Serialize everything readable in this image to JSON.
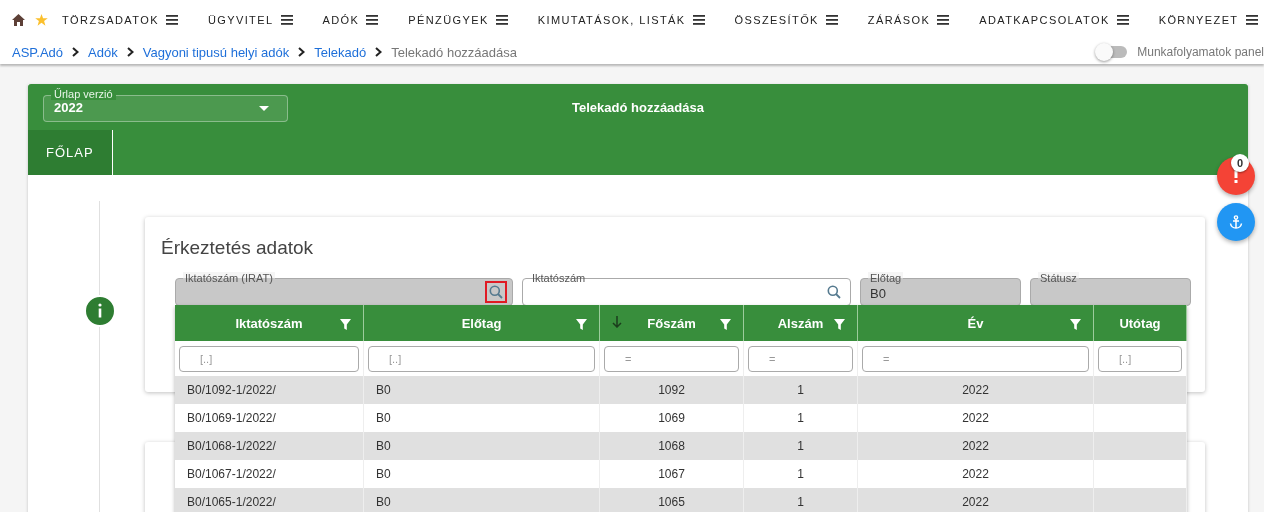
{
  "nav": {
    "items": [
      {
        "label": "TÖRZSADATOK"
      },
      {
        "label": "ÜGYVITEL"
      },
      {
        "label": "ADÓK"
      },
      {
        "label": "PÉNZÜGYEK"
      },
      {
        "label": "KIMUTATÁSOK, LISTÁK"
      },
      {
        "label": "ÖSSZESÍTŐK"
      },
      {
        "label": "ZÁRÁSOK"
      },
      {
        "label": "ADATKAPCSOLATOK"
      },
      {
        "label": "KÖRNYEZET"
      }
    ]
  },
  "breadcrumb": [
    {
      "label": "ASP.Adó",
      "link": true
    },
    {
      "label": "Adók",
      "link": true
    },
    {
      "label": "Vagyoni tipusú helyi adók",
      "link": true
    },
    {
      "label": "Telekadó",
      "link": true
    },
    {
      "label": "Telekadó hozzáadása",
      "link": false
    }
  ],
  "workflow_toggle": {
    "label": "Munkafolyamatok panel",
    "on": false
  },
  "form": {
    "version_select": {
      "label": "Űrlap verzió",
      "value": "2022"
    },
    "title": "Telekadó hozzáadása",
    "tabs": [
      {
        "label": "FŐLAP",
        "selected": true
      }
    ]
  },
  "section": {
    "title": "Érkeztetés adatok",
    "fields": [
      {
        "label": "Iktatószám (IRAT)",
        "disabled": true,
        "search": true,
        "search_focused": true
      },
      {
        "label": "Iktatószám",
        "disabled": false,
        "search": true,
        "search_focused": false
      },
      {
        "label": "Előtag",
        "value": "B0",
        "disabled": true,
        "search": false
      },
      {
        "label": "Státusz",
        "disabled": true,
        "search": false
      }
    ]
  },
  "lookup_grid": {
    "columns": [
      {
        "label": "Iktatószám",
        "filter_placeholder": "[..]",
        "kind": "text",
        "sorted": false,
        "filter_icon": true
      },
      {
        "label": "Előtag",
        "filter_placeholder": "[..]",
        "kind": "text",
        "sorted": false,
        "filter_icon": true
      },
      {
        "label": "Főszám",
        "filter_placeholder": "=",
        "kind": "number",
        "sorted": true,
        "filter_icon": true
      },
      {
        "label": "Alszám",
        "filter_placeholder": "=",
        "kind": "number",
        "sorted": false,
        "filter_icon": true
      },
      {
        "label": "Év",
        "filter_placeholder": "=",
        "kind": "number",
        "sorted": false,
        "filter_icon": true
      },
      {
        "label": "Utótag",
        "filter_placeholder": "[..]",
        "kind": "text",
        "sorted": false,
        "filter_icon": false
      }
    ],
    "rows": [
      [
        "B0/1092-1/2022/",
        "B0",
        "1092",
        "1",
        "2022"
      ],
      [
        "B0/1069-1/2022/",
        "B0",
        "1069",
        "1",
        "2022"
      ],
      [
        "B0/1068-1/2022/",
        "B0",
        "1068",
        "1",
        "2022"
      ],
      [
        "B0/1067-1/2022/",
        "B0",
        "1067",
        "1",
        "2022"
      ],
      [
        "B0/1065-1/2022/",
        "B0",
        "1065",
        "1",
        "2022"
      ]
    ]
  },
  "alert_button": {
    "count": "0"
  }
}
